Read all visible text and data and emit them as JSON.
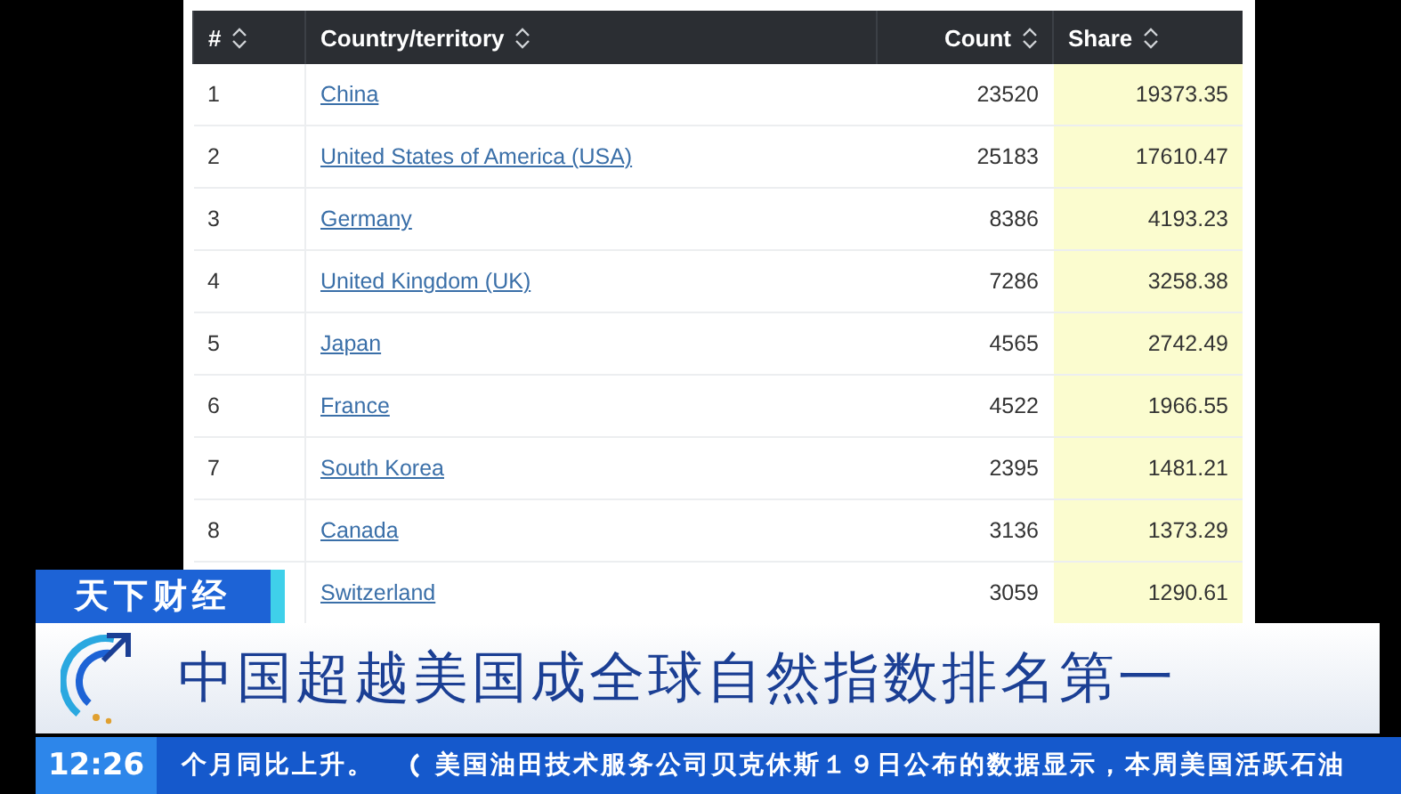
{
  "table": {
    "columns": [
      {
        "label": "#"
      },
      {
        "label": "Country/territory"
      },
      {
        "label": "Count"
      },
      {
        "label": "Share"
      }
    ],
    "rows": [
      {
        "rank": "1",
        "country": "China",
        "count": "23520",
        "share": "19373.35"
      },
      {
        "rank": "2",
        "country": "United States of America (USA)",
        "count": "25183",
        "share": "17610.47"
      },
      {
        "rank": "3",
        "country": "Germany",
        "count": "8386",
        "share": "4193.23"
      },
      {
        "rank": "4",
        "country": "United Kingdom (UK)",
        "count": "7286",
        "share": "3258.38"
      },
      {
        "rank": "5",
        "country": "Japan",
        "count": "4565",
        "share": "2742.49"
      },
      {
        "rank": "6",
        "country": "France",
        "count": "4522",
        "share": "1966.55"
      },
      {
        "rank": "7",
        "country": "South Korea",
        "count": "2395",
        "share": "1481.21"
      },
      {
        "rank": "8",
        "country": "Canada",
        "count": "3136",
        "share": "1373.29"
      },
      {
        "country": "Switzerland",
        "count": "3059",
        "share": "1290.61"
      }
    ]
  },
  "banner": {
    "section": "天下财经",
    "headline": "中国超越美国成全球自然指数排名第一",
    "time": "12:26",
    "ticker": [
      "个月同比上升。",
      "美国油田技术服务公司贝克休斯１９日公布的数据显示，本周美国活跃石油"
    ]
  }
}
